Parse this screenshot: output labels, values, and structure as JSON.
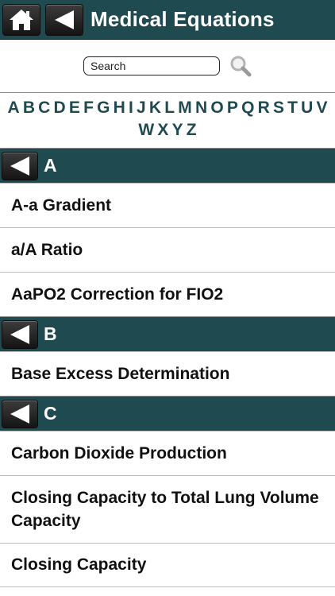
{
  "header": {
    "title": "Medical Equations",
    "home_icon": "home-icon",
    "back_icon": "back-arrow-icon",
    "background": "#1f4a50"
  },
  "search": {
    "placeholder": "Search",
    "value": "Search",
    "icon": "magnifier-icon"
  },
  "alphabet": [
    "A",
    "B",
    "C",
    "D",
    "E",
    "F",
    "G",
    "H",
    "I",
    "J",
    "K",
    "L",
    "M",
    "N",
    "O",
    "P",
    "Q",
    "R",
    "S",
    "T",
    "U",
    "V",
    "W",
    "X",
    "Y",
    "Z"
  ],
  "sections": [
    {
      "letter": "A",
      "items": [
        "A-a Gradient",
        "a/A Ratio",
        "AaPO2 Correction for FIO2"
      ]
    },
    {
      "letter": "B",
      "items": [
        "Base Excess Determination"
      ]
    },
    {
      "letter": "C",
      "items": [
        "Carbon Dioxide Production",
        "Closing Capacity to Total Lung Volume Capacity",
        "Closing Capacity"
      ]
    }
  ]
}
